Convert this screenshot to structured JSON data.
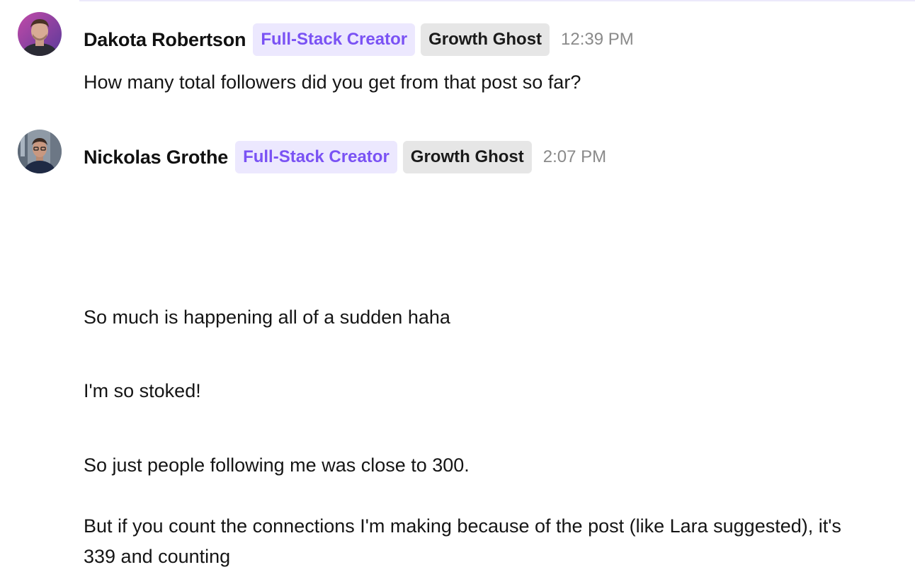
{
  "messages": [
    {
      "author": "Dakota Robertson",
      "role_badge": "Full-Stack Creator",
      "tier_badge": "Growth Ghost",
      "time": "12:39 PM",
      "avatar": "user-avatar-photo",
      "paragraphs": [
        "How many total followers did you get from that post so far?"
      ]
    },
    {
      "author": "Nickolas Grothe",
      "role_badge": "Full-Stack Creator",
      "tier_badge": "Growth Ghost",
      "time": "2:07 PM",
      "avatar": "user-avatar-photo",
      "paragraphs": [
        "So much is happening all of a sudden haha",
        "I'm so stoked!",
        "So just people following me was close to 300.",
        "But if you count the connections I'm making because of the post (like Lara suggested), it's 339 and counting"
      ]
    }
  ],
  "colors": {
    "role_badge_bg": "#ece8fe",
    "role_badge_text": "#7a52f4",
    "tier_badge_bg": "#e6e6e6",
    "timestamp": "#8a8a8a"
  }
}
